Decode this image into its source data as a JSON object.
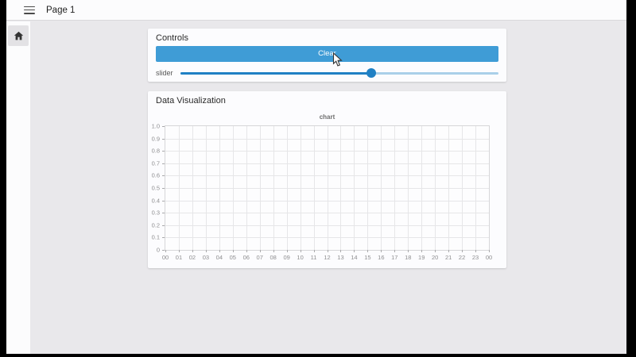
{
  "topbar": {
    "title": "Page 1",
    "menu_icon": "hamburger-icon"
  },
  "sidebar": {
    "home_icon": "home-icon"
  },
  "controls": {
    "title": "Controls",
    "clear_button_label": "Clear",
    "slider_label": "slider",
    "slider_percent": 60
  },
  "visualization": {
    "title": "Data Visualization"
  },
  "chart_data": {
    "type": "line",
    "title": "chart",
    "series": [],
    "x_tick_labels": [
      "00",
      "01",
      "02",
      "03",
      "04",
      "05",
      "06",
      "07",
      "08",
      "09",
      "10",
      "11",
      "12",
      "13",
      "14",
      "15",
      "16",
      "17",
      "18",
      "19",
      "20",
      "21",
      "22",
      "23",
      "00"
    ],
    "y_tick_labels": [
      "1.0",
      "0.9",
      "0.8",
      "0.7",
      "0.6",
      "0.5",
      "0.4",
      "0.3",
      "0.2",
      "0.1",
      "0"
    ],
    "ylim": [
      0,
      1.0
    ],
    "grid": true,
    "legend": null,
    "plot_empty": true
  },
  "colors": {
    "frame_black": "#000000",
    "button_blue": "#3f9cd6",
    "slider_fill_blue": "#1f80c4",
    "slider_track_blue": "#a9cfe9",
    "content_gray": "#e9e8eb",
    "card_white": "#fcfcfe",
    "grid_gray": "#e6e6e8"
  }
}
